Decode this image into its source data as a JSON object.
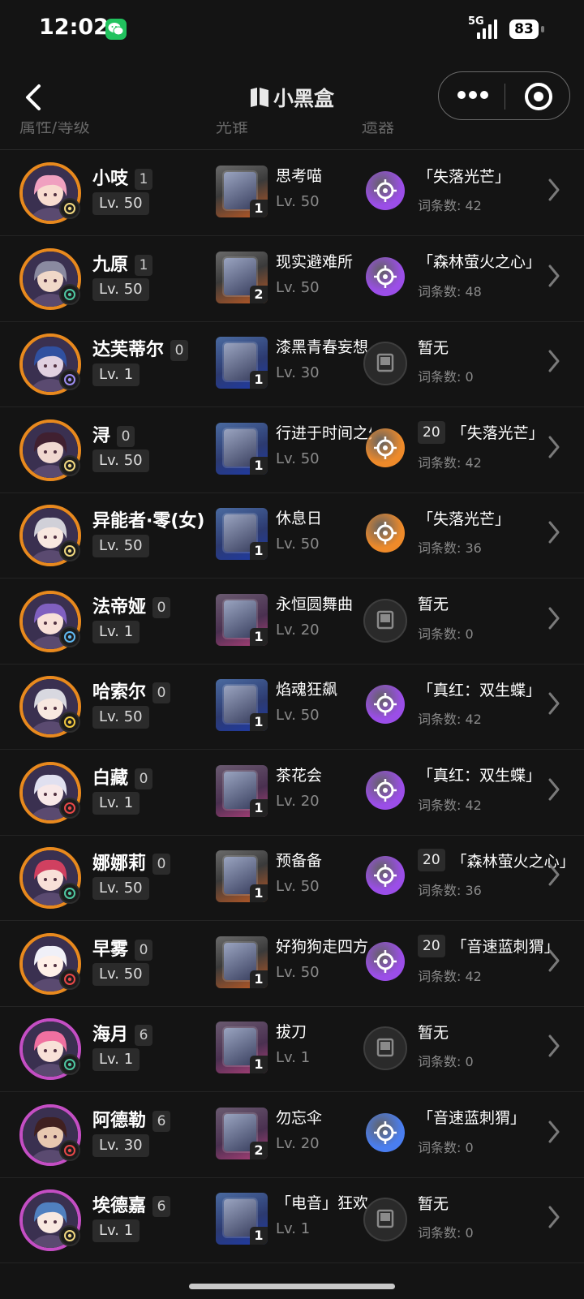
{
  "status_bar": {
    "time": "12:02",
    "network": "5G",
    "battery": "83"
  },
  "nav": {
    "brand": "小黑盒"
  },
  "header_columns": [
    "属性/等级",
    "光锥",
    "遗器"
  ],
  "characters": [
    {
      "name": "小吱",
      "eidolon": "1",
      "level": "Lv. 50",
      "element": "imaginary",
      "rarity": 4,
      "lightcone": {
        "name": "思考喵",
        "sup": "1",
        "level": "Lv. 50"
      },
      "relic": {
        "set": "「失落光芒」",
        "count": "",
        "terms": "词条数: 42",
        "color": "#9b4ee8"
      }
    },
    {
      "name": "九原",
      "eidolon": "1",
      "level": "Lv. 50",
      "element": "wind",
      "rarity": 4,
      "lightcone": {
        "name": "现实避难所",
        "sup": "2",
        "level": "Lv. 50"
      },
      "relic": {
        "set": "「森林萤火之心」",
        "count": "",
        "terms": "词条数: 48",
        "color": "#9b4ee8"
      }
    },
    {
      "name": "达芙蒂尔",
      "eidolon": "0",
      "level": "Lv. 1",
      "element": "quantum",
      "rarity": 4,
      "lightcone": {
        "name": "漆黑青春妄想",
        "sup": "1",
        "level": "Lv. 30"
      },
      "relic": {
        "set": "暂无",
        "count": "",
        "terms": "词条数: 0",
        "color": ""
      }
    },
    {
      "name": "浔",
      "eidolon": "0",
      "level": "Lv. 50",
      "element": "imaginary",
      "rarity": 4,
      "lightcone": {
        "name": "行进于时间之外",
        "sup": "1",
        "level": "Lv. 50"
      },
      "relic": {
        "set": "「失落光芒」",
        "count": "20",
        "terms": "词条数: 42",
        "color": "#ee8a2a"
      }
    },
    {
      "name": "异能者·零(女)",
      "eidolon": "",
      "level": "Lv. 50",
      "element": "imaginary",
      "rarity": 4,
      "lightcone": {
        "name": "休息日",
        "sup": "1",
        "level": "Lv. 50"
      },
      "relic": {
        "set": "「失落光芒」",
        "count": "",
        "terms": "词条数: 36",
        "color": "#ee8a2a"
      }
    },
    {
      "name": "法帝娅",
      "eidolon": "0",
      "level": "Lv. 1",
      "element": "ice",
      "rarity": 4,
      "lightcone": {
        "name": "永恒圆舞曲",
        "sup": "1",
        "level": "Lv. 20"
      },
      "relic": {
        "set": "暂无",
        "count": "",
        "terms": "词条数: 0",
        "color": ""
      }
    },
    {
      "name": "哈索尔",
      "eidolon": "0",
      "level": "Lv. 50",
      "element": "lightning",
      "rarity": 4,
      "lightcone": {
        "name": "焰魂狂飙",
        "sup": "1",
        "level": "Lv. 50"
      },
      "relic": {
        "set": "「真红：双生蝶」",
        "count": "",
        "terms": "词条数: 42",
        "color": "#9b4ee8"
      }
    },
    {
      "name": "白藏",
      "eidolon": "0",
      "level": "Lv. 1",
      "element": "fire",
      "rarity": 4,
      "lightcone": {
        "name": "茶花会",
        "sup": "1",
        "level": "Lv. 20"
      },
      "relic": {
        "set": "「真红：双生蝶」",
        "count": "",
        "terms": "词条数: 42",
        "color": "#9b4ee8"
      }
    },
    {
      "name": "娜娜莉",
      "eidolon": "0",
      "level": "Lv. 50",
      "element": "wind",
      "rarity": 4,
      "lightcone": {
        "name": "预备备",
        "sup": "1",
        "level": "Lv. 50"
      },
      "relic": {
        "set": "「森林萤火之心」",
        "count": "20",
        "terms": "词条数: 36",
        "color": "#9b4ee8"
      }
    },
    {
      "name": "早雾",
      "eidolon": "0",
      "level": "Lv. 50",
      "element": "fire",
      "rarity": 4,
      "lightcone": {
        "name": "好狗狗走四方",
        "sup": "1",
        "level": "Lv. 50"
      },
      "relic": {
        "set": "「音速蓝刺猬」",
        "count": "20",
        "terms": "词条数: 42",
        "color": "#9b4ee8"
      }
    },
    {
      "name": "海月",
      "eidolon": "6",
      "level": "Lv. 1",
      "element": "wind",
      "rarity": 3,
      "lightcone": {
        "name": "拔刀",
        "sup": "1",
        "level": "Lv. 1"
      },
      "relic": {
        "set": "暂无",
        "count": "",
        "terms": "词条数: 0",
        "color": ""
      }
    },
    {
      "name": "阿德勒",
      "eidolon": "6",
      "level": "Lv. 30",
      "element": "fire",
      "rarity": 3,
      "lightcone": {
        "name": "勿忘伞",
        "sup": "2",
        "level": "Lv. 20"
      },
      "relic": {
        "set": "「音速蓝刺猬」",
        "count": "",
        "terms": "词条数: 0",
        "color": "#4a7ef0"
      }
    },
    {
      "name": "埃德嘉",
      "eidolon": "6",
      "level": "Lv. 1",
      "element": "imaginary",
      "rarity": 3,
      "lightcone": {
        "name": "「电音」狂欢",
        "sup": "1",
        "level": "Lv. 1"
      },
      "relic": {
        "set": "暂无",
        "count": "",
        "terms": "词条数: 0",
        "color": ""
      }
    }
  ]
}
